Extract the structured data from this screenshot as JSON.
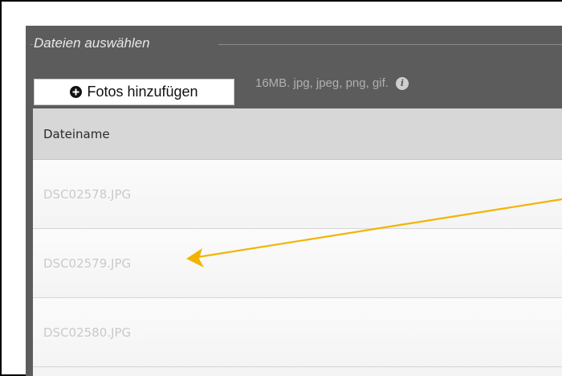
{
  "upload": {
    "legend": "Dateien auswählen",
    "add_button_label": "Fotos hinzufügen",
    "allowed_hint": "16MB. jpg, jpeg, png, gif.",
    "info_icon_glyph": "i"
  },
  "table": {
    "header": "Dateiname",
    "rows": [
      {
        "filename": "DSC02578.JPG"
      },
      {
        "filename": "DSC02579.JPG"
      },
      {
        "filename": "DSC02580.JPG"
      }
    ]
  },
  "colors": {
    "panel_bg": "#5c5c5c",
    "arrow": "#f2b400",
    "header_bg": "#d7d7d7",
    "filename_text": "#cacaca"
  },
  "icons": {
    "add": "plus-circle-icon",
    "info": "info-icon",
    "annotation": "arrow-icon"
  }
}
